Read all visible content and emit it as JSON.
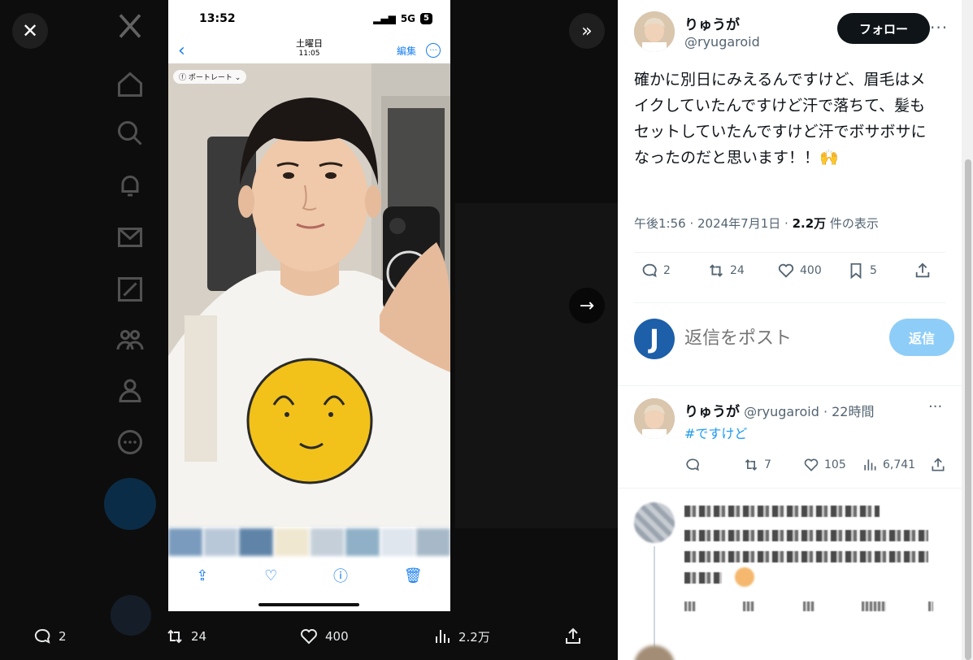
{
  "media": {
    "next_icon": "arrow-right-icon",
    "phone": {
      "time": "13:52",
      "network": "5G",
      "battery": "5",
      "nav_day": "土曜日",
      "nav_time": "11:05",
      "edit_label": "編集",
      "portrait_label": "ポートレート"
    },
    "actions": {
      "replies": "2",
      "reposts": "24",
      "likes": "400",
      "views": "2.2万"
    }
  },
  "tweet": {
    "author_name": "りゅうが",
    "author_handle": "@ryugaroid",
    "follow_label": "フォロー",
    "text": "確かに別日にみえるんですけど、眉毛はメイクしていたんですけど汗で落ちて、髪もセットしていたんですけど汗でボサボサになったのだと思います！！🙌",
    "time": "午後1:56 · 2024年7月1日 · ",
    "views_count": "2.2万",
    "views_suffix": " 件の表示",
    "stats": {
      "replies": "2",
      "reposts": "24",
      "likes": "400",
      "bookmarks": "5"
    }
  },
  "reply_box": {
    "avatar_letter": "J",
    "placeholder": "返信をポスト",
    "button_label": "返信"
  },
  "reply": {
    "author_name": "りゅうが",
    "meta": " @ryugaroid · 22時間",
    "hashtag": "#ですけど",
    "stats": {
      "replies": "",
      "reposts": "7",
      "likes": "105",
      "views": "6,741"
    }
  },
  "colors": {
    "accent": "#1d9bf0",
    "reply_button": "#8ecdf8",
    "text_primary": "#0f1419",
    "text_secondary": "#536471"
  }
}
